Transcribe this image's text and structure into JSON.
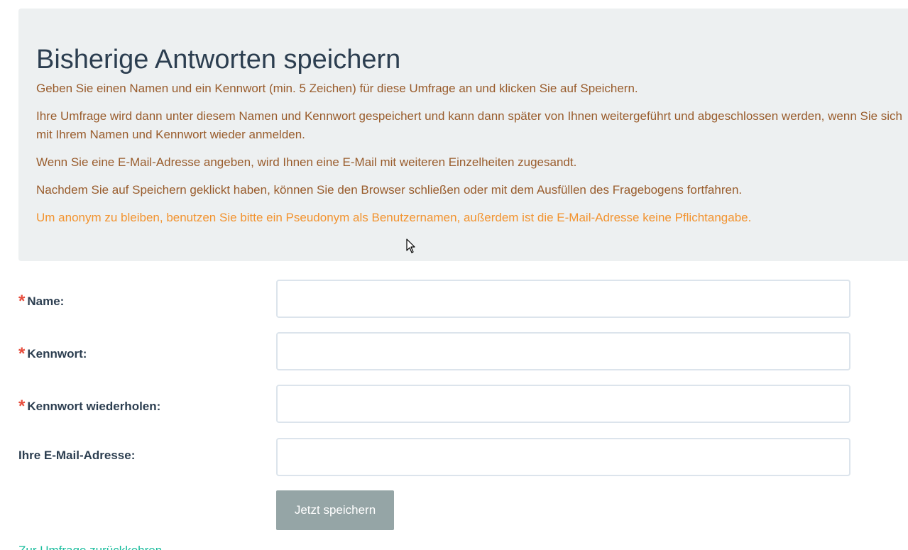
{
  "intro": {
    "title": "Bisherige Antworten speichern",
    "p1": "Geben Sie einen Namen und ein Kennwort (min. 5 Zeichen) für diese Umfrage an und klicken Sie auf Speichern.",
    "p2": "Ihre Umfrage wird dann unter diesem Namen und Kennwort gespeichert und kann dann später von Ihnen weitergeführt und abgeschlossen werden, wenn Sie sich mit Ihrem Namen und Kennwort wieder anmelden.",
    "p3": "Wenn Sie eine E-Mail-Adresse angeben, wird Ihnen eine E-Mail mit weiteren Einzelheiten zugesandt.",
    "p4": "Nachdem Sie auf Speichern geklickt haben, können Sie den Browser schließen oder mit dem Ausfüllen des Fragebogens fortfahren.",
    "p5": "Um anonym zu bleiben, benutzen Sie bitte ein Pseudonym als Benutzernamen, außerdem ist die E-Mail-Adresse keine Pflichtangabe."
  },
  "form": {
    "required_mark": "*",
    "name_label": "Name:",
    "name_value": "",
    "password_label": "Kennwort:",
    "password_value": "",
    "password_repeat_label": "Kennwort wiederholen:",
    "password_repeat_value": "",
    "email_label": "Ihre E-Mail-Adresse:",
    "email_value": "",
    "save_label": "Jetzt speichern"
  },
  "back_link": "Zur Umfrage zurückkehren",
  "colors": {
    "title": "#2c3e50",
    "info_text": "#995c2c",
    "warning_text": "#f2932f",
    "required_star": "#e74c3c",
    "button_bg": "#95a5a6",
    "link": "#18bc9c",
    "intro_bg": "#edf0f1"
  }
}
